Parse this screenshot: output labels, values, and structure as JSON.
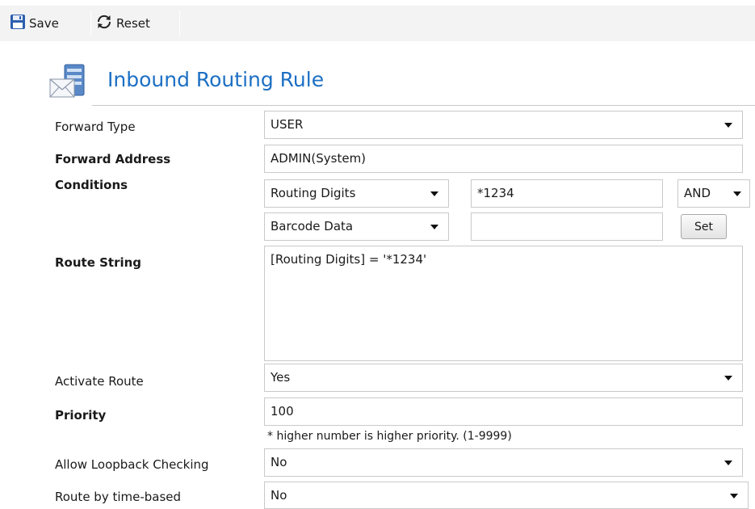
{
  "toolbar": {
    "save_label": "Save",
    "reset_label": "Reset"
  },
  "header": {
    "title": "Inbound Routing Rule",
    "icon": "routing-mail-server-icon"
  },
  "form": {
    "forward_type": {
      "label": "Forward Type",
      "value": "USER"
    },
    "forward_address": {
      "label": "Forward Address",
      "value": "ADMIN(System)"
    },
    "conditions": {
      "label": "Conditions",
      "row1": {
        "field": "Routing Digits",
        "value": "*1234",
        "operator": "AND"
      },
      "row2": {
        "field": "Barcode Data",
        "value": "",
        "set_label": "Set"
      }
    },
    "route_string": {
      "label": "Route String",
      "value": "[Routing Digits] = '*1234'"
    },
    "activate_route": {
      "label": "Activate Route",
      "value": "Yes"
    },
    "priority": {
      "label": "Priority",
      "value": "100",
      "hint": "* higher number is higher priority. (1-9999)"
    },
    "allow_loopback": {
      "label": "Allow Loopback Checking",
      "value": "No"
    },
    "route_by_time": {
      "label": "Route by time-based",
      "value": "No"
    }
  },
  "colors": {
    "title_blue": "#1c6fc4",
    "toolbar_bg": "#f3f3f3",
    "field_border": "#c9c9c9"
  }
}
